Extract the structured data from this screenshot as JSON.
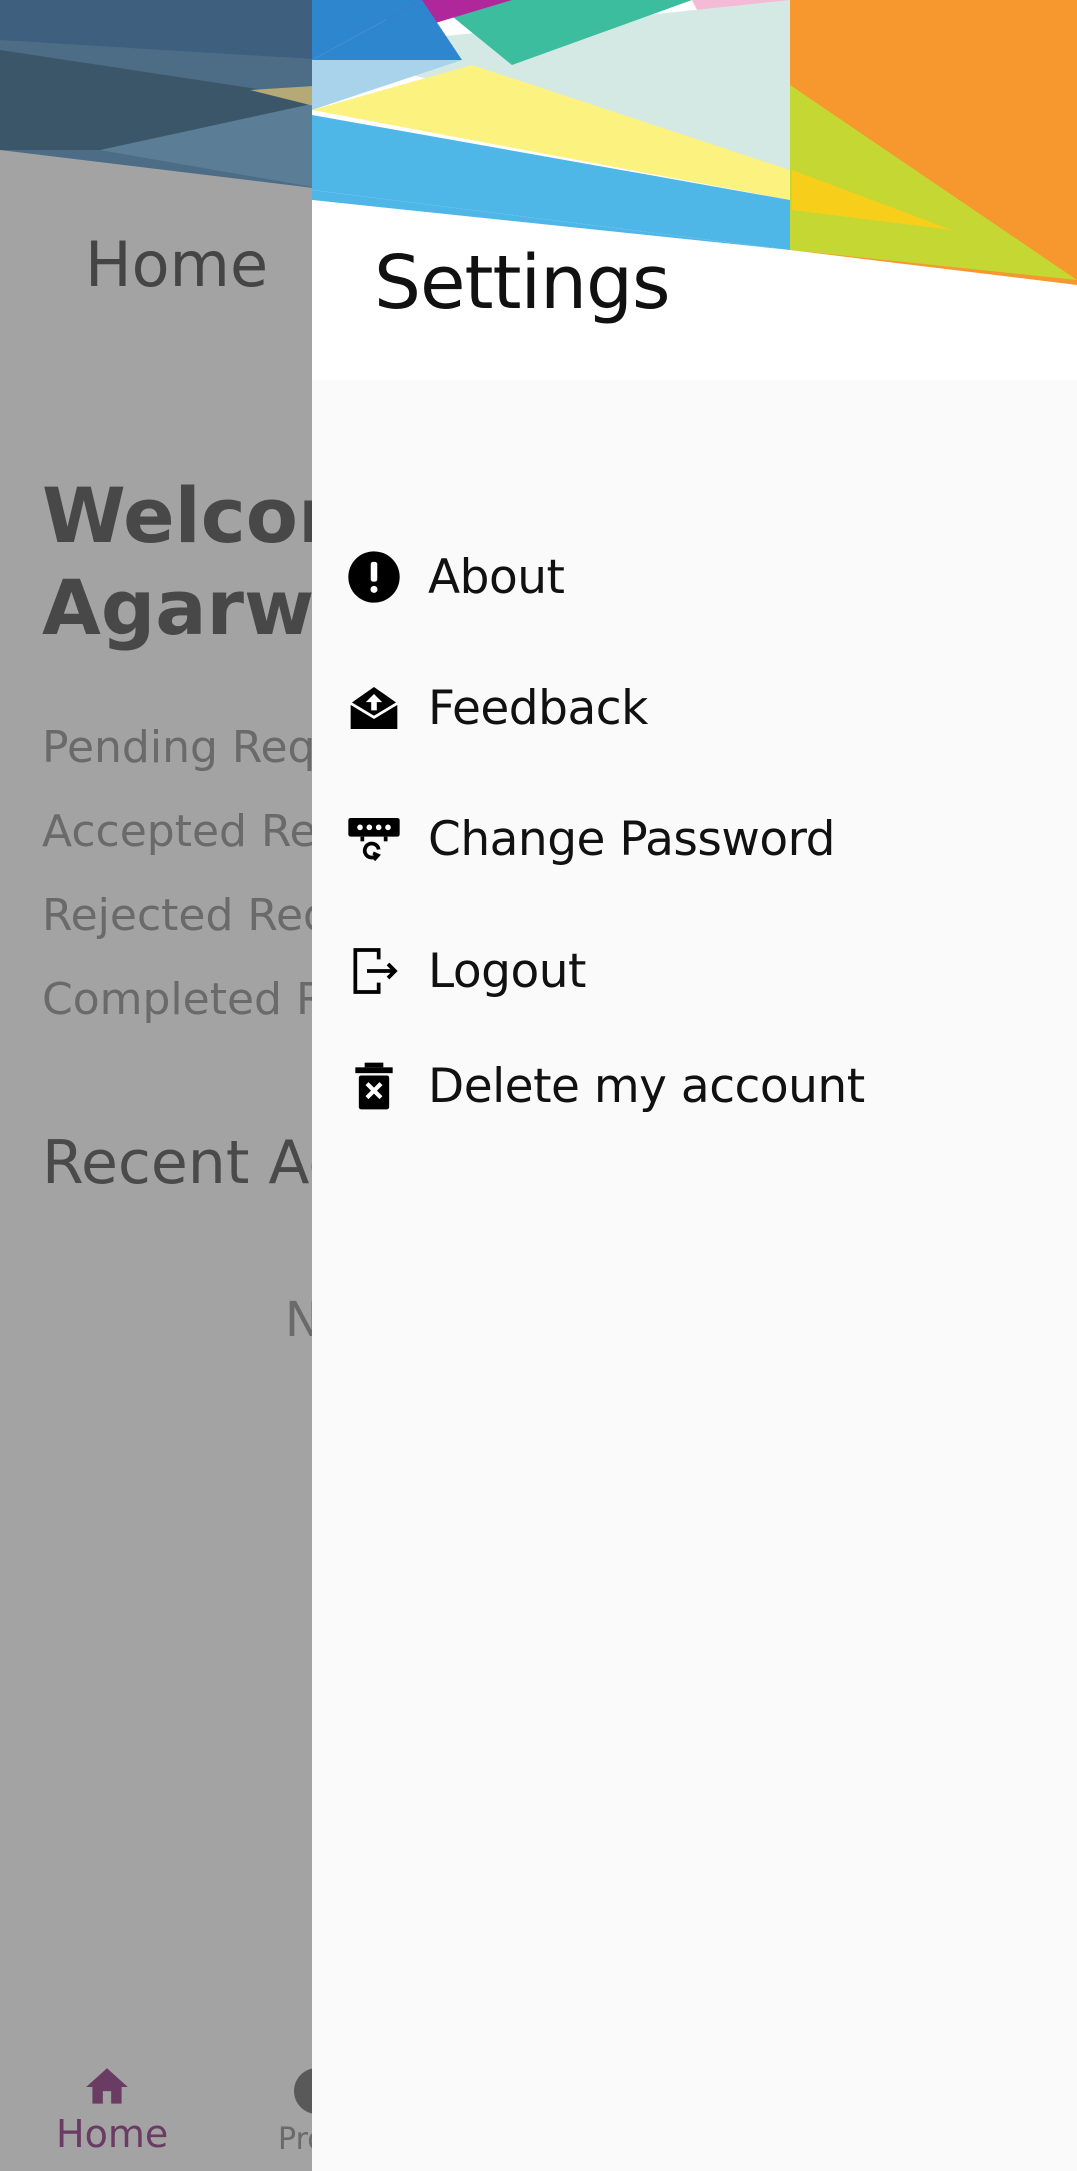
{
  "background_app": {
    "title": "Home",
    "welcome_line1": "Welcon",
    "welcome_line2": "Agarwa",
    "stats": [
      "Pending Req",
      "Accepted Re",
      "Rejected Req",
      "Completed R"
    ],
    "recent_heading": "Recent Ac",
    "empty_text": "N",
    "bottom_nav": {
      "home_label": "Home",
      "profile_label": "Pro",
      "accent_color": "#6a3b63"
    }
  },
  "drawer": {
    "title": "Settings",
    "items": [
      {
        "label": "About",
        "icon": "info-alert-icon"
      },
      {
        "label": "Feedback",
        "icon": "mail-open-icon"
      },
      {
        "label": "Change Password",
        "icon": "password-reset-icon"
      },
      {
        "label": "Logout",
        "icon": "logout-icon"
      },
      {
        "label": "Delete my account",
        "icon": "delete-trash-icon"
      }
    ]
  },
  "colors": {
    "scrim": "#a3a3a3",
    "drawer_bg": "#fafafa",
    "header_orange": "#f7982f",
    "header_yellow": "#fbf27f",
    "header_blue": "#4fb7e8",
    "header_lime": "#c4d732"
  }
}
